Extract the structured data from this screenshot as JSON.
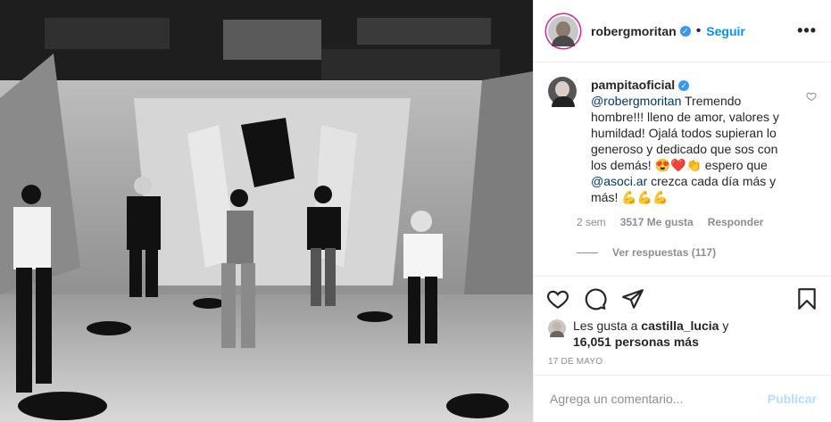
{
  "header": {
    "username": "robergmoritan",
    "separator": "•",
    "follow_label": "Seguir",
    "more_label": "•••"
  },
  "comment": {
    "username": "pampitaoficial",
    "mention1": "@robergmoritan",
    "text1": " Tremendo hombre!!! lleno de amor, valores y humildad! Ojalá todos supieran lo generoso y dedicado que sos con los demás! ",
    "emoji1": "😍❤️👏",
    "text2": " espero que ",
    "mention2": "@asoci.ar",
    "text3": " crezca cada día más y más! ",
    "emoji2": "💪💪💪",
    "time": "2 sem",
    "likes": "3517 Me gusta",
    "reply_label": "Responder",
    "view_replies": "Ver respuestas (117)"
  },
  "liked_by": {
    "prefix": "Les gusta a ",
    "user": "castilla_lucia",
    "middle": " y",
    "count": "16,051 personas más"
  },
  "date": "17 de mayo",
  "add_comment": {
    "placeholder": "Agrega un comentario...",
    "publish_label": "Publicar"
  },
  "colors": {
    "link_blue": "#0095f6",
    "verified_blue": "#3897f0",
    "muted": "#8e8e8e",
    "publish_disabled": "#b2dffc"
  }
}
